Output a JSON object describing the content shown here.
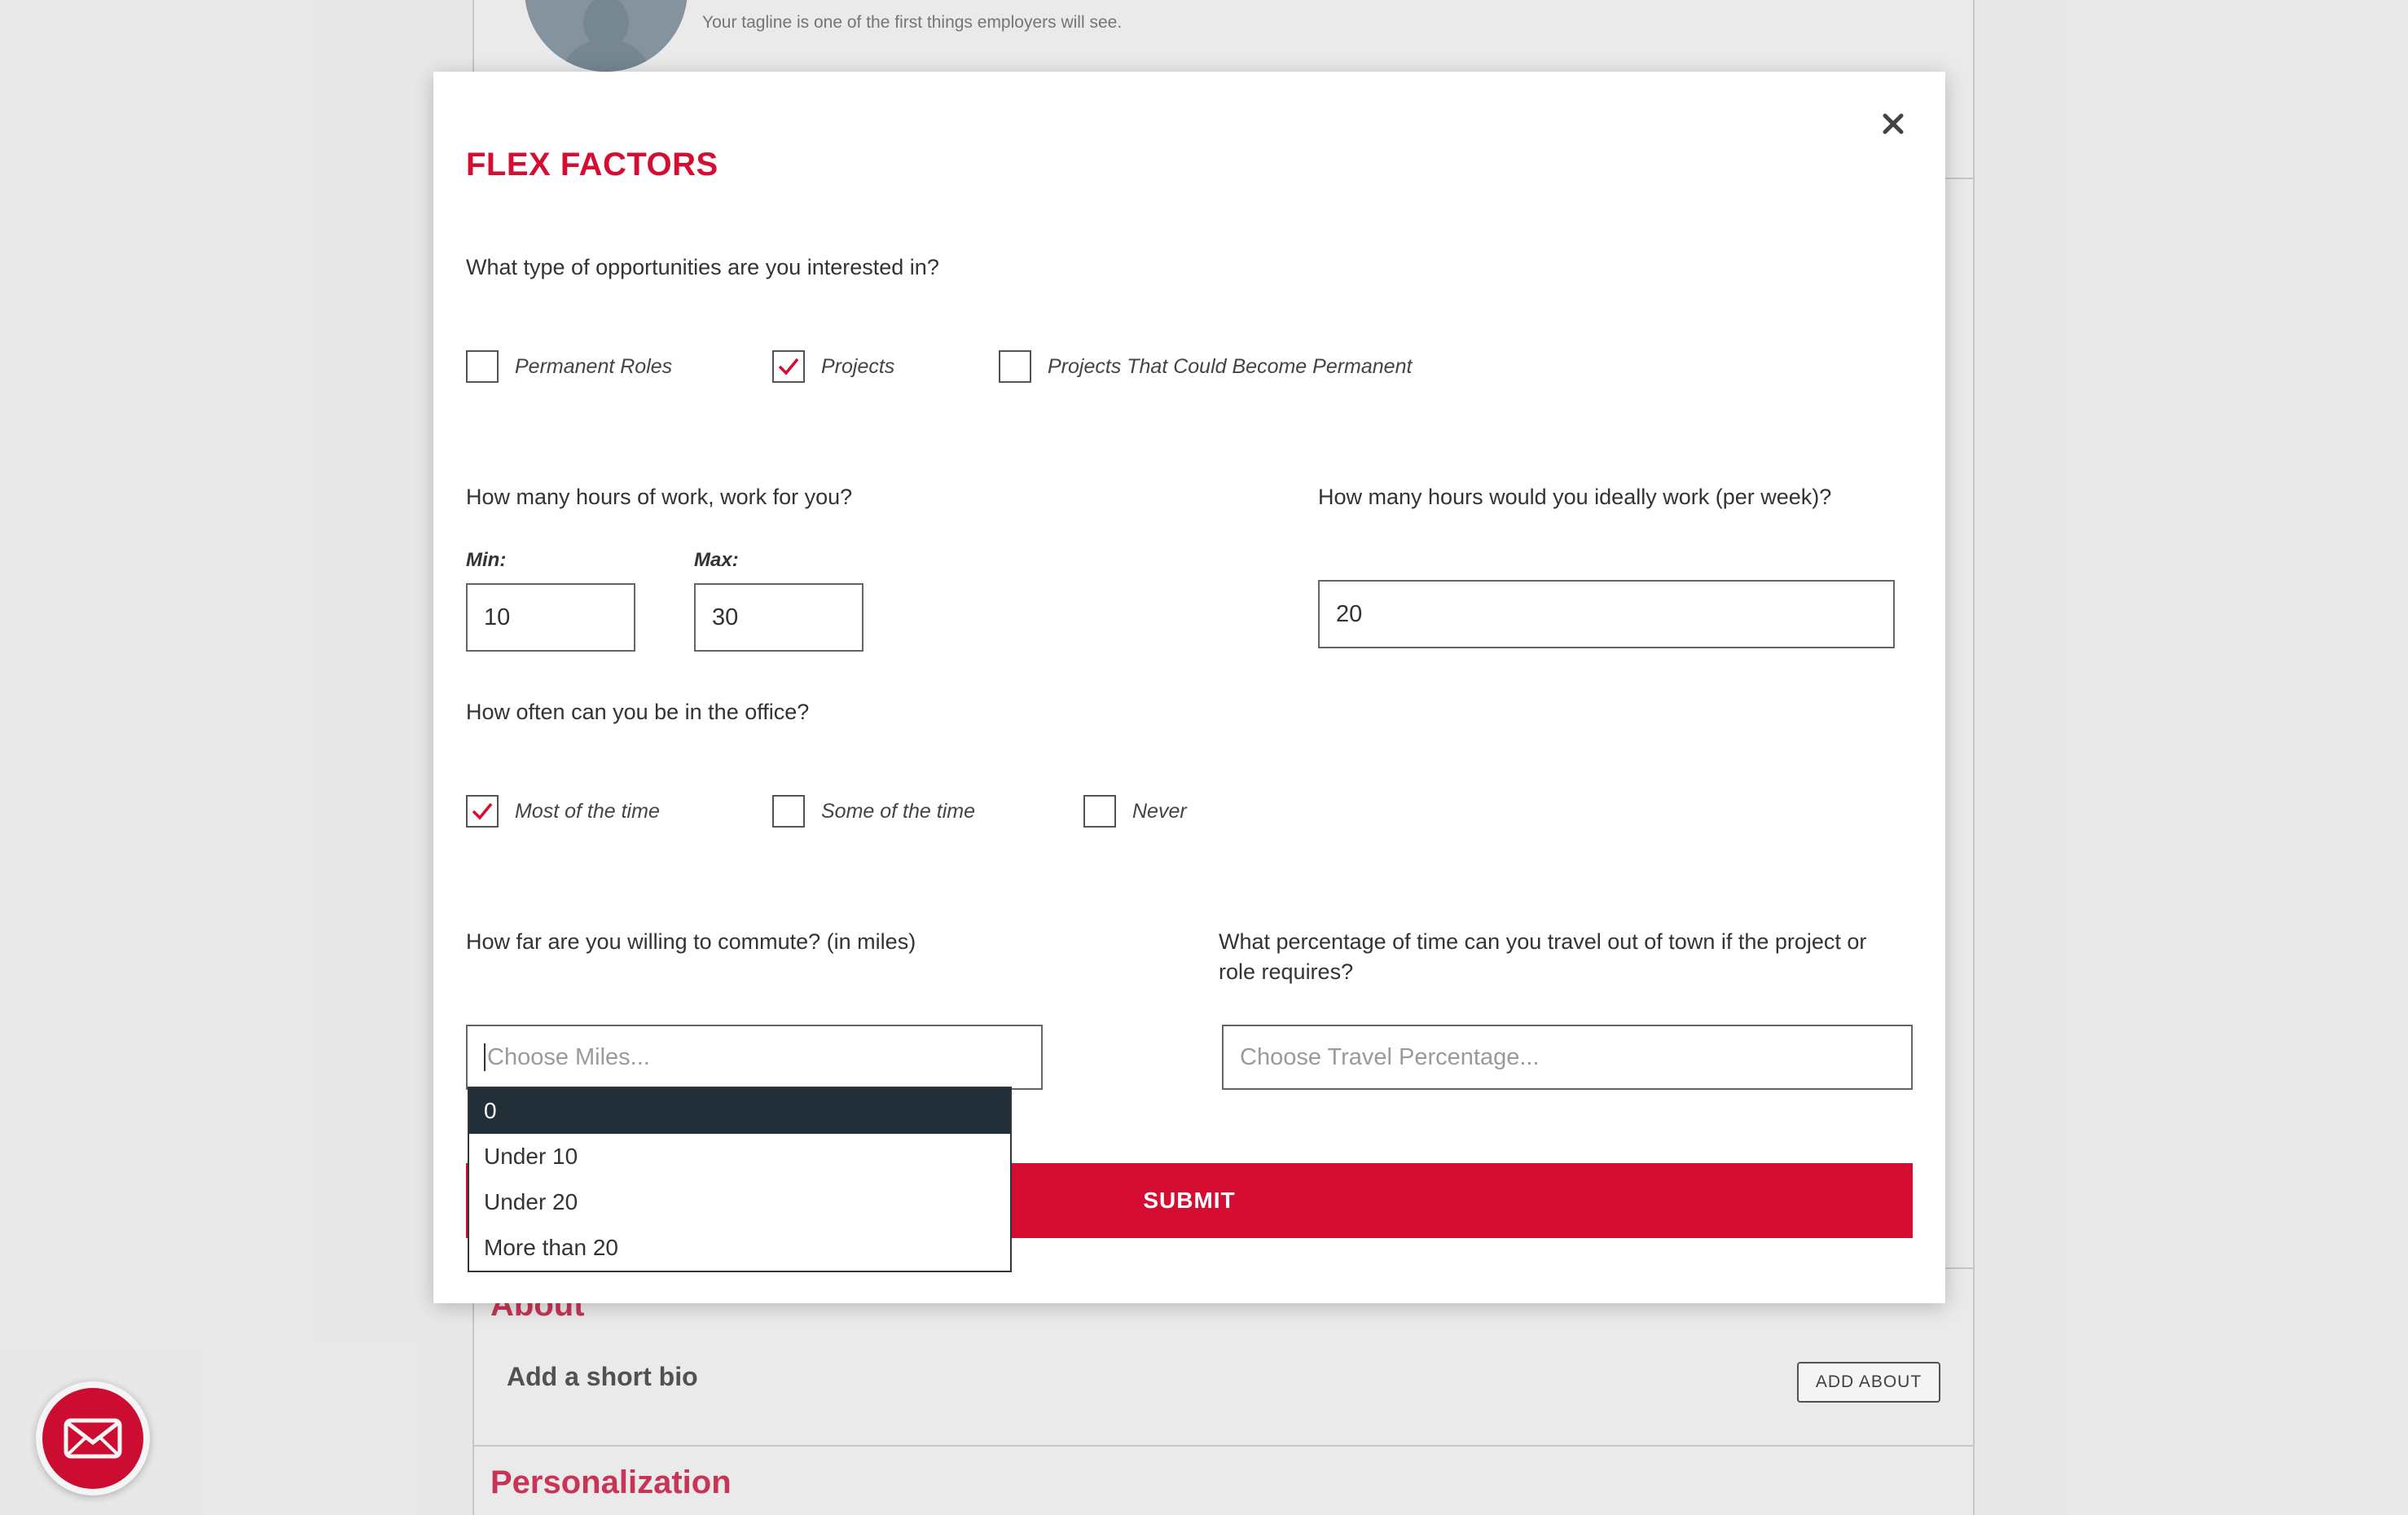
{
  "background": {
    "tagline": "Your tagline is one of the first things employers will see.",
    "about_title": "About",
    "about_bio": "Add a short bio",
    "add_about_button": "ADD ABOUT",
    "personalization_title": "Personalization"
  },
  "modal": {
    "title": "FLEX FACTORS",
    "close_icon": "close-icon",
    "opportunities": {
      "question": "What type of opportunities are you interested in?",
      "options": [
        {
          "label": "Permanent Roles",
          "checked": false
        },
        {
          "label": "Projects",
          "checked": true
        },
        {
          "label": "Projects That Could Become Permanent",
          "checked": false
        }
      ]
    },
    "hours": {
      "question": "How many hours of work, work for you?",
      "min_label": "Min:",
      "min_value": "10",
      "max_label": "Max:",
      "max_value": "30"
    },
    "ideal_hours": {
      "question": "How many hours would you ideally work (per week)?",
      "value": "20"
    },
    "office": {
      "question": "How often can you be in the office?",
      "options": [
        {
          "label": "Most of the time",
          "checked": true
        },
        {
          "label": "Some of the time",
          "checked": false
        },
        {
          "label": "Never",
          "checked": false
        }
      ]
    },
    "commute": {
      "question": "How far are you willing to commute? (in miles)",
      "placeholder": "Choose Miles...",
      "options": [
        "0",
        "Under 10",
        "Under 20",
        "More than 20"
      ],
      "highlighted_index": 0
    },
    "travel": {
      "question_line1": "What percentage of time can you travel out of town if the project or",
      "question_line2": "role requires?",
      "placeholder": "Choose Travel Percentage..."
    },
    "submit_label": "SUBMIT"
  },
  "colors": {
    "brand_red": "#d50d32",
    "section_pink": "#d1375a",
    "dropdown_highlight": "#232f38"
  }
}
